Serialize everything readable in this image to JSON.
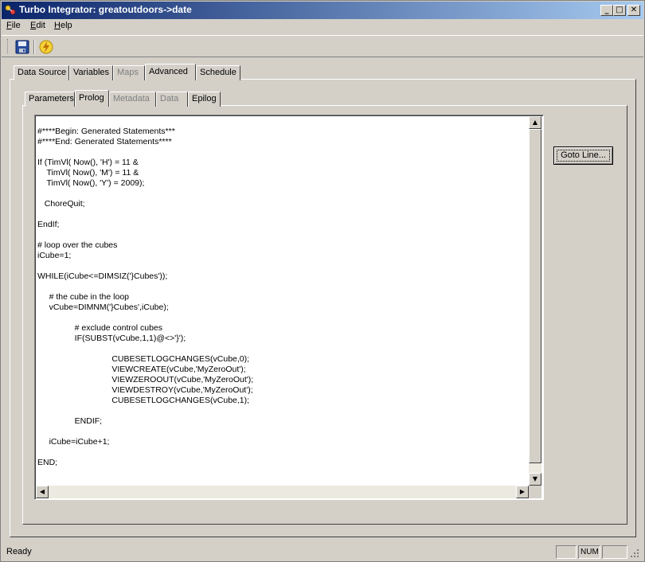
{
  "window": {
    "title": "Turbo Integrator:  greatoutdoors->date",
    "minimize_glyph": "_",
    "maximize_glyph": "□",
    "close_glyph": "✕"
  },
  "menu": {
    "file": {
      "u": "F",
      "rest": "ile"
    },
    "edit": {
      "u": "E",
      "rest": "dit"
    },
    "help": {
      "u": "H",
      "rest": "elp"
    }
  },
  "toolbar": {
    "save_icon": "floppy-disk-icon",
    "run_icon": "lightning-icon"
  },
  "main_tabs": [
    {
      "label": "Data Source",
      "enabled": true
    },
    {
      "label": "Variables",
      "enabled": true
    },
    {
      "label": "Maps",
      "enabled": false
    },
    {
      "label": "Advanced",
      "enabled": true,
      "active": true
    },
    {
      "label": "Schedule",
      "enabled": true
    }
  ],
  "sub_tabs": [
    {
      "label": "Parameters",
      "enabled": true
    },
    {
      "label": "Prolog",
      "enabled": true,
      "active": true
    },
    {
      "label": "Metadata",
      "enabled": false
    },
    {
      "label": "Data",
      "enabled": false
    },
    {
      "label": "Epilog",
      "enabled": true
    }
  ],
  "editor": {
    "code": "#****Begin: Generated Statements***\n#****End: Generated Statements****\n\nIf (TimVl( Now(), 'H') = 11 &\n    TimVl( Now(), 'M') = 11 &\n    TimVl( Now(), 'Y') = 2009);\n\n   ChoreQuit;\n\nEndIf;\n\n# loop over the cubes\niCube=1;\n\nWHILE(iCube<=DIMSIZ('}Cubes'));\n\n     # the cube in the loop\n     vCube=DIMNM('}Cubes',iCube);\n\n                # exclude control cubes\n                IF(SUBST(vCube,1,1)@<>'}');\n\n                                CUBESETLOGCHANGES(vCube,0);\n                                VIEWCREATE(vCube,'MyZeroOut');\n                                VIEWZEROOUT(vCube,'MyZeroOut');\n                                VIEWDESTROY(vCube,'MyZeroOut');\n                                CUBESETLOGCHANGES(vCube,1);\n\n                ENDIF;\n\n     iCube=iCube+1;\n\nEND;",
    "scroll_up": "▲",
    "scroll_down": "▼",
    "scroll_left": "◀",
    "scroll_right": "▶"
  },
  "goto_button": "Goto Line...",
  "status": {
    "text": "Ready",
    "num": "NUM"
  }
}
